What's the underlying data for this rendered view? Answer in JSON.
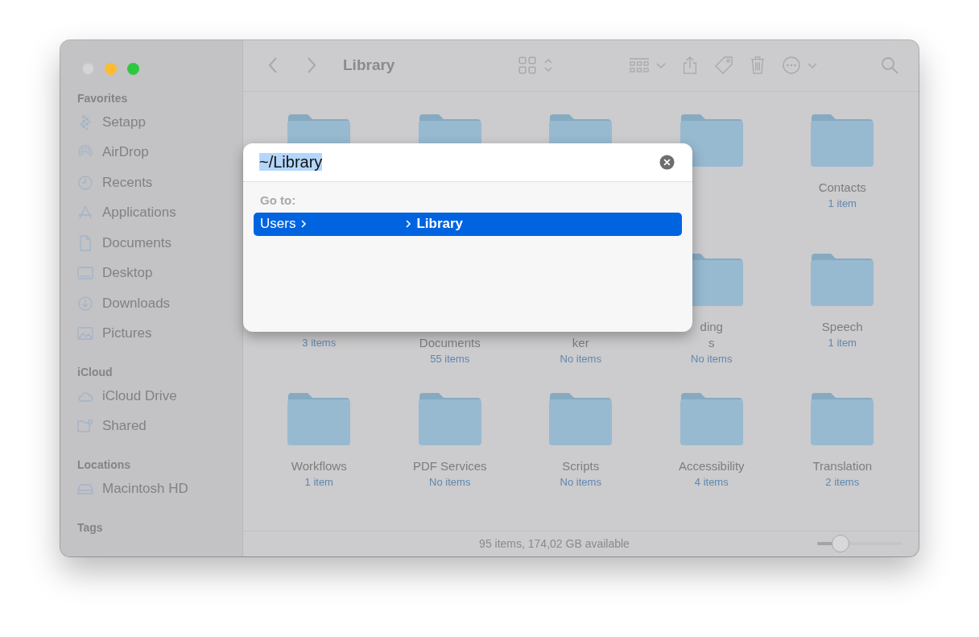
{
  "window": {
    "title": "Library"
  },
  "sidebar": {
    "sections": [
      {
        "title": "Favorites",
        "items": [
          {
            "label": "Setapp"
          },
          {
            "label": "AirDrop"
          },
          {
            "label": "Recents"
          },
          {
            "label": "Applications"
          },
          {
            "label": "Documents"
          },
          {
            "label": "Desktop"
          },
          {
            "label": "Downloads"
          },
          {
            "label": "Pictures"
          }
        ]
      },
      {
        "title": "iCloud",
        "items": [
          {
            "label": "iCloud Drive"
          },
          {
            "label": "Shared"
          }
        ]
      },
      {
        "title": "Locations",
        "items": [
          {
            "label": "Macintosh HD"
          }
        ]
      },
      {
        "title": "Tags"
      }
    ]
  },
  "folders": [
    {
      "kind": "hidden"
    },
    {
      "kind": "hidden"
    },
    {
      "kind": "hidden"
    },
    {
      "kind": "hidden"
    },
    {
      "kind": "shown",
      "lines": [
        "Contacts"
      ],
      "count": "1 item"
    },
    {
      "kind": "tail",
      "count": "3 items"
    },
    {
      "kind": "tail",
      "lines": [
        "Documents"
      ],
      "count": "55 items"
    },
    {
      "kind": "tail",
      "lines": [
        "ker"
      ],
      "count": "No items"
    },
    {
      "kind": "shown",
      "lines": [
        "ding",
        "s"
      ],
      "count": "No items"
    },
    {
      "kind": "shown",
      "lines": [
        "Speech"
      ],
      "count": "1 item"
    },
    {
      "kind": "shown",
      "lines": [
        "Workflows"
      ],
      "count": "1 item"
    },
    {
      "kind": "shown",
      "lines": [
        "PDF Services"
      ],
      "count": "No items"
    },
    {
      "kind": "shown",
      "lines": [
        "Scripts"
      ],
      "count": "No items"
    },
    {
      "kind": "shown",
      "lines": [
        "Accessibility"
      ],
      "count": "4 items"
    },
    {
      "kind": "shown",
      "lines": [
        "Translation"
      ],
      "count": "2 items"
    }
  ],
  "status_bar": {
    "text": "95 items, 174,02 GB available",
    "zoom": {
      "level": 0.27
    }
  },
  "go_to_dialog": {
    "path_field": {
      "value": "~/Library",
      "text_selected": true
    },
    "label": "Go to:",
    "results": [
      {
        "first": "Users",
        "last": "Library",
        "selected": true
      }
    ]
  }
}
